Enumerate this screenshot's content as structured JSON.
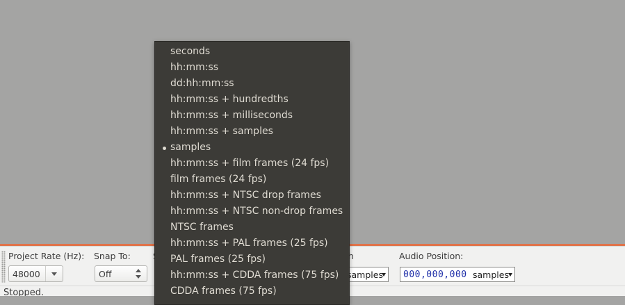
{
  "toolbar": {
    "project_rate_label": "Project Rate (Hz):",
    "project_rate_value": "48000",
    "snap_to_label": "Snap To:",
    "snap_to_value": "Off",
    "selection_partial_label": "S",
    "length_label_partial": "th",
    "selection_unit": "samples",
    "audio_position_label": "Audio Position:",
    "audio_position_value": "000,000,000",
    "audio_position_unit": "samples"
  },
  "status": {
    "text": "Stopped."
  },
  "format_menu": {
    "items": [
      {
        "label": "seconds",
        "selected": false
      },
      {
        "label": "hh:mm:ss",
        "selected": false
      },
      {
        "label": "dd:hh:mm:ss",
        "selected": false
      },
      {
        "label": "hh:mm:ss + hundredths",
        "selected": false
      },
      {
        "label": "hh:mm:ss + milliseconds",
        "selected": false
      },
      {
        "label": "hh:mm:ss + samples",
        "selected": false
      },
      {
        "label": "samples",
        "selected": true
      },
      {
        "label": "hh:mm:ss + film frames (24 fps)",
        "selected": false
      },
      {
        "label": "film frames (24 fps)",
        "selected": false
      },
      {
        "label": "hh:mm:ss + NTSC drop frames",
        "selected": false
      },
      {
        "label": "hh:mm:ss + NTSC non-drop frames",
        "selected": false
      },
      {
        "label": "NTSC frames",
        "selected": false
      },
      {
        "label": "hh:mm:ss + PAL frames (25 fps)",
        "selected": false
      },
      {
        "label": "PAL frames (25 fps)",
        "selected": false
      },
      {
        "label": "hh:mm:ss + CDDA frames (75 fps)",
        "selected": false
      },
      {
        "label": "CDDA frames (75 fps)",
        "selected": false
      }
    ]
  },
  "colors": {
    "accent": "#e0734a",
    "menu_background": "#3c3b37",
    "menu_text": "#dfdbd2",
    "time_digits": "#1f2fa8"
  },
  "icons": {
    "rate_dropdown": "chevron-down-icon",
    "snap_spin": "spin-arrows-icon",
    "unit_dropdown": "triangle-down-icon",
    "selected_bullet": "bullet-icon"
  }
}
